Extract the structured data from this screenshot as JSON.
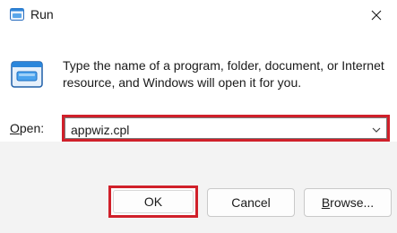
{
  "window": {
    "title": "Run",
    "title_icon": "run-icon",
    "close_icon": "close-icon"
  },
  "content": {
    "icon": "run-icon",
    "description": "Type the name of a program, folder, document, or Internet resource, and Windows will open it for you.",
    "open_label_mnemonic": "O",
    "open_label_rest": "pen:",
    "open_value": "appwiz.cpl"
  },
  "buttons": {
    "ok_label": "OK",
    "cancel_label": "Cancel",
    "browse_mnemonic": "B",
    "browse_rest": "rowse..."
  },
  "colors": {
    "highlight": "#d0202a",
    "icon_blue": "#1f7bd1"
  }
}
